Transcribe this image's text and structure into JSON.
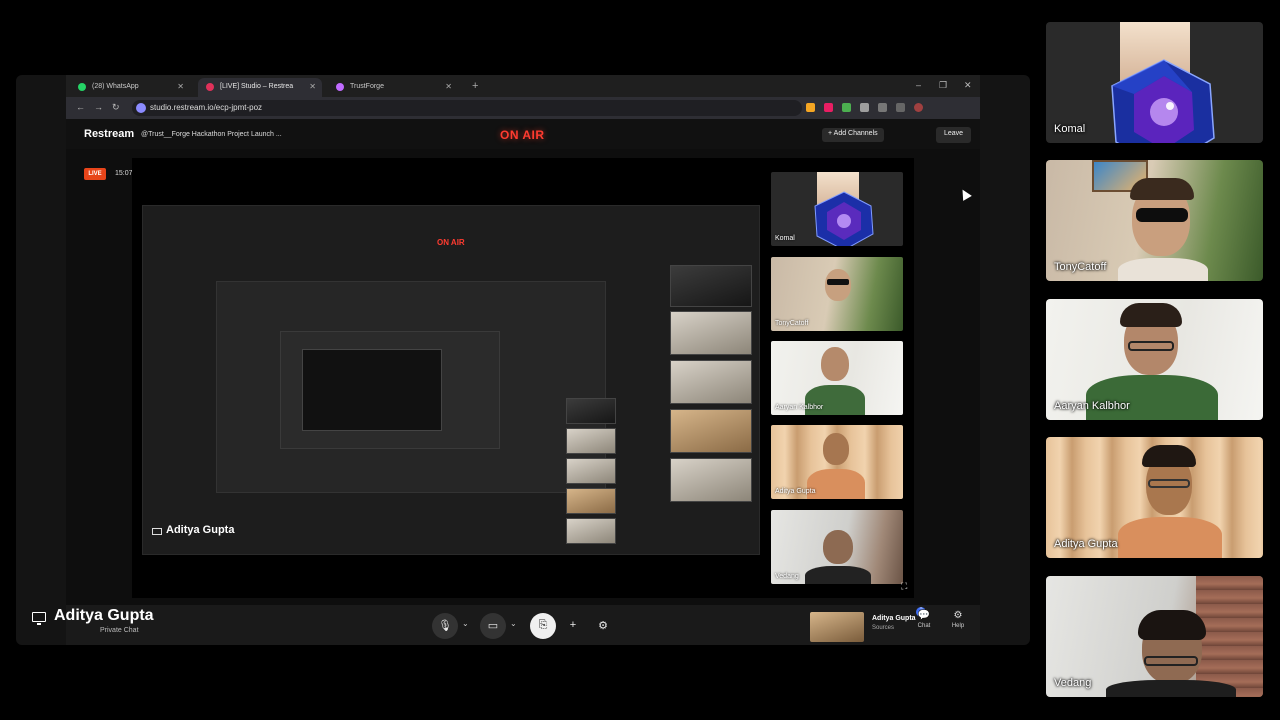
{
  "browser": {
    "tabs": [
      {
        "label": "(28) WhatsApp",
        "color": "#25d366"
      },
      {
        "label": "[LIVE] Studio – Restrea",
        "color": "#e0315a"
      },
      {
        "label": "TrustForge",
        "color": "#c06bff"
      }
    ],
    "url": "studio.restream.io/ecp-jpmt-poz"
  },
  "app": {
    "logo": "Restream",
    "stream_title": "@Trust__Forge Hackathon Project Launch ...",
    "on_air": "ON AIR",
    "add_channels": "+ Add Channels",
    "leave": "Leave",
    "live_badge": "LIVE",
    "timer": "15:07"
  },
  "canvas": {
    "presenter": "Aditya Gupta",
    "inner_tiles": [
      {
        "name": "Komal"
      },
      {
        "name": "TonyCatoff"
      },
      {
        "name": "Aaryan Kalbhor"
      },
      {
        "name": "Aditya Gupta"
      },
      {
        "name": "Vedang"
      }
    ]
  },
  "bottom": {
    "presenter": "Aditya Gupta",
    "private_chat": "Private Chat",
    "source_name": "Aditya Gupta",
    "source_sub": "Sources",
    "source_badge": "2",
    "chat": "Chat",
    "help": "Help"
  },
  "participants": [
    {
      "name": "Komal"
    },
    {
      "name": "TonyCatoff"
    },
    {
      "name": "Aaryan Kalbhor"
    },
    {
      "name": "Aditya Gupta"
    },
    {
      "name": "Vedang"
    }
  ]
}
